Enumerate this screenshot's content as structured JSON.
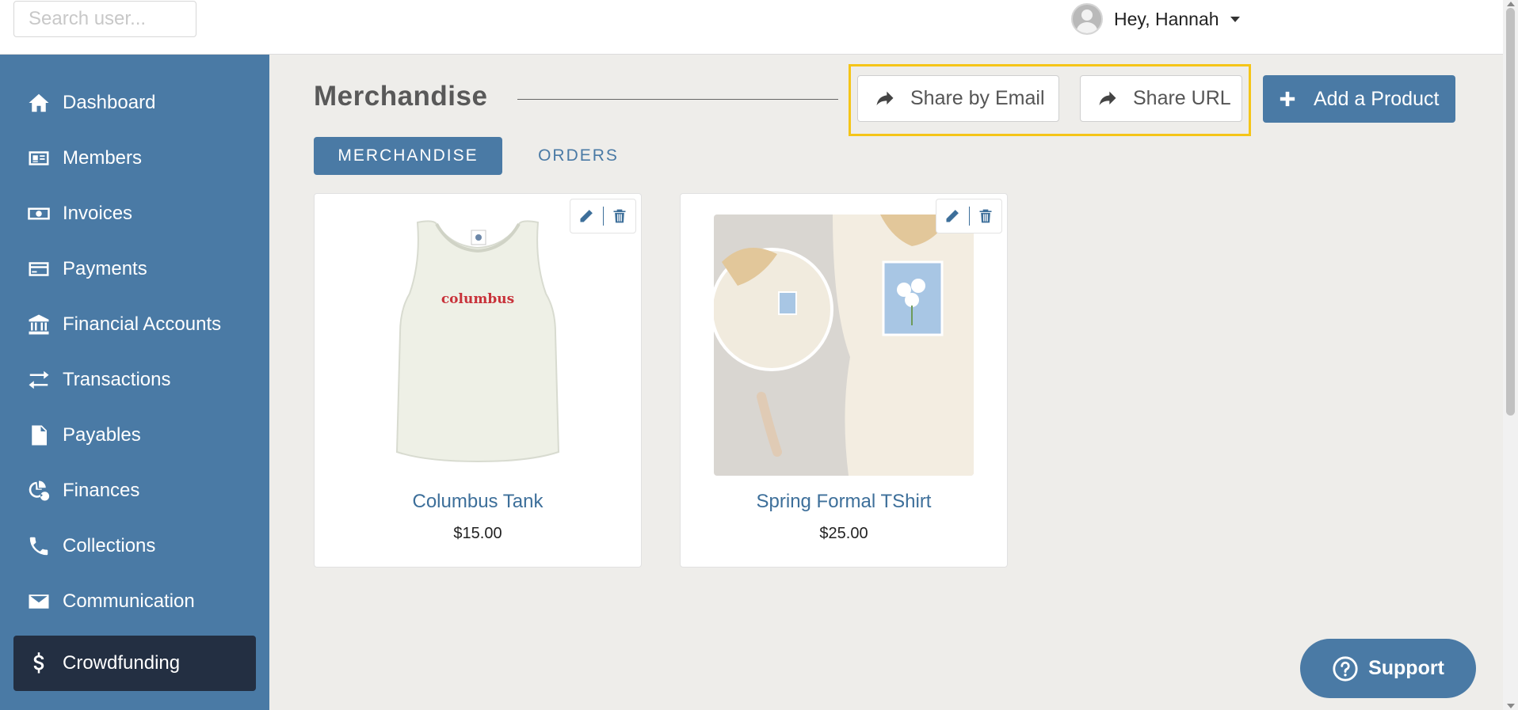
{
  "search": {
    "placeholder": "Search user..."
  },
  "user": {
    "greeting": "Hey, Hannah"
  },
  "sidebar": {
    "items": [
      {
        "label": "Dashboard",
        "icon": "home-icon"
      },
      {
        "label": "Members",
        "icon": "id-card-icon"
      },
      {
        "label": "Invoices",
        "icon": "money-bill-icon"
      },
      {
        "label": "Payments",
        "icon": "credit-card-icon"
      },
      {
        "label": "Financial Accounts",
        "icon": "bank-icon"
      },
      {
        "label": "Transactions",
        "icon": "exchange-icon"
      },
      {
        "label": "Payables",
        "icon": "invoice-dollar-icon"
      },
      {
        "label": "Finances",
        "icon": "pie-chart-dollar-icon"
      },
      {
        "label": "Collections",
        "icon": "phone-icon"
      },
      {
        "label": "Communication",
        "icon": "envelope-icon"
      },
      {
        "label": "Crowdfunding",
        "icon": "dollar-icon",
        "active": true
      }
    ]
  },
  "main": {
    "title": "Merchandise",
    "share_email_label": "Share by Email",
    "share_url_label": "Share URL",
    "add_product_label": "Add a Product",
    "tabs": [
      {
        "label": "MERCHANDISE",
        "active": true
      },
      {
        "label": "ORDERS",
        "active": false
      }
    ],
    "products": [
      {
        "name": "Columbus Tank",
        "price": "$15.00",
        "image_text": "columbus"
      },
      {
        "name": "Spring Formal TShirt",
        "price": "$25.00"
      }
    ]
  },
  "support": {
    "label": "Support"
  },
  "colors": {
    "primary": "#4a7aa5",
    "sidebar_active": "#232f42",
    "highlight": "#f5c518",
    "background": "#eeedea"
  }
}
